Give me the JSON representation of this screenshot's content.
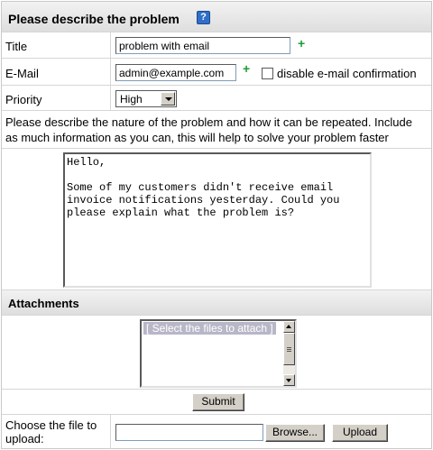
{
  "form": {
    "title": "Please describe the problem",
    "help_icon": "?",
    "fields": {
      "title_label": "Title",
      "title_value": "problem with email",
      "email_label": "E-Mail",
      "email_value": "admin@example.com",
      "disable_confirm_label": "disable e-mail confirmation",
      "priority_label": "Priority",
      "priority_value": "High"
    },
    "plus_symbol": "+",
    "instructions": "Please describe the nature of the problem and how it can be repeated. Include as much information as you can, this will help to solve your problem faster",
    "message": "Hello,\n\nSome of my customers didn't receive email\ninvoice notifications yesterday. Could you\nplease explain what the problem is?"
  },
  "attachments": {
    "heading": "Attachments",
    "list_placeholder": "[ Select the files to attach ]",
    "submit_label": "Submit",
    "upload_label": "Choose the file to upload:",
    "browse_label": "Browse...",
    "upload_button": "Upload"
  },
  "colors": {
    "plus": "#1e9b35",
    "help_icon": "#2f6fc9",
    "header_bg": "#e6e6e6"
  }
}
